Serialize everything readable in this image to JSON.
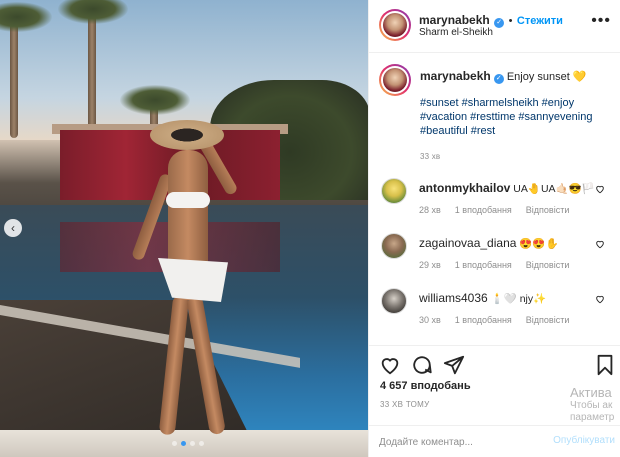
{
  "post": {
    "username": "marynabekh",
    "follow_label": "Стежити",
    "location": "Sharm el-Sheikh",
    "more_label": "•••",
    "caption_text": "Enjoy sunset",
    "caption_emoji": "💛",
    "hashtags": "#sunset #sharmelsheikh #enjoy #vacation #resttime #sannyevening #beautiful #rest",
    "caption_time": "33 хв",
    "likes": "4 657 вподобань",
    "posted_ago": "33 ХВ ТОМУ",
    "comment_placeholder": "Додайте коментар...",
    "publish_label": "Опублікувати"
  },
  "comments": [
    {
      "username": "antonmykhailov",
      "text": "UA🤚UA🤙🏻😎🏳️",
      "time": "28 хв",
      "likes": "1 вподобання",
      "reply": "Відповісти"
    },
    {
      "username": "zagainovaa_diana",
      "text": "😍😍✋",
      "time": "29 хв",
      "likes": "1 вподобання",
      "reply": "Відповісти"
    },
    {
      "username": "williams4036",
      "text": "🕯️🤍 njy✨",
      "time": "30 хв",
      "likes": "1 вподобання",
      "reply": "Відповісти"
    }
  ],
  "carousel": {
    "prev_label": "‹",
    "slide_count": 4,
    "active_index": 1
  },
  "watermark": {
    "title": "Актива",
    "line1": "Чтобы ак",
    "line2": "параметр"
  },
  "colors": {
    "accent": "#0095f6",
    "verified": "#3897f0",
    "text": "#262626",
    "muted": "#8e8e8e",
    "hashtag": "#00376b"
  }
}
